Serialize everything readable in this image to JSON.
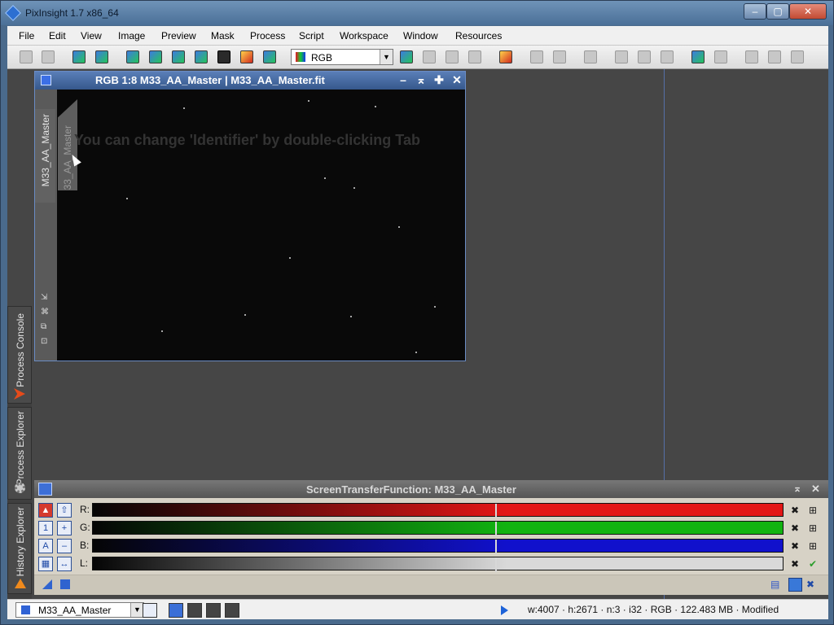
{
  "app": {
    "title": "PixInsight 1.7 x86_64"
  },
  "menu": [
    "File",
    "Edit",
    "View",
    "Image",
    "Preview",
    "Mask",
    "Process",
    "Script",
    "Workspace",
    "Window",
    "Resources"
  ],
  "toolbar": {
    "colorspace_value": "RGB"
  },
  "image_window": {
    "title": "RGB 1:8 M33_AA_Master | M33_AA_Master.fit",
    "identifier_tab": "M33_AA_Master",
    "identifier_tab_ghost": "M33_AA_Master",
    "tip_text": "You can change 'Identifier' by double-clicking Tab"
  },
  "side_tabs": {
    "process_console": "Process Console",
    "process_explorer": "Process Explorer",
    "history_explorer": "History Explorer"
  },
  "stf": {
    "title": "ScreenTransferFunction: M33_AA_Master",
    "channels": [
      {
        "label": "R:",
        "color": "#e31616"
      },
      {
        "label": "G:",
        "color": "#11b311"
      },
      {
        "label": "B:",
        "color": "#1111cc"
      },
      {
        "label": "L:",
        "color": "#d9d9d9"
      }
    ]
  },
  "status": {
    "view": "M33_AA_Master",
    "info": "w:4007 · h:2671 · n:3 · i32 · RGB · 122.483 MB · Modified"
  }
}
